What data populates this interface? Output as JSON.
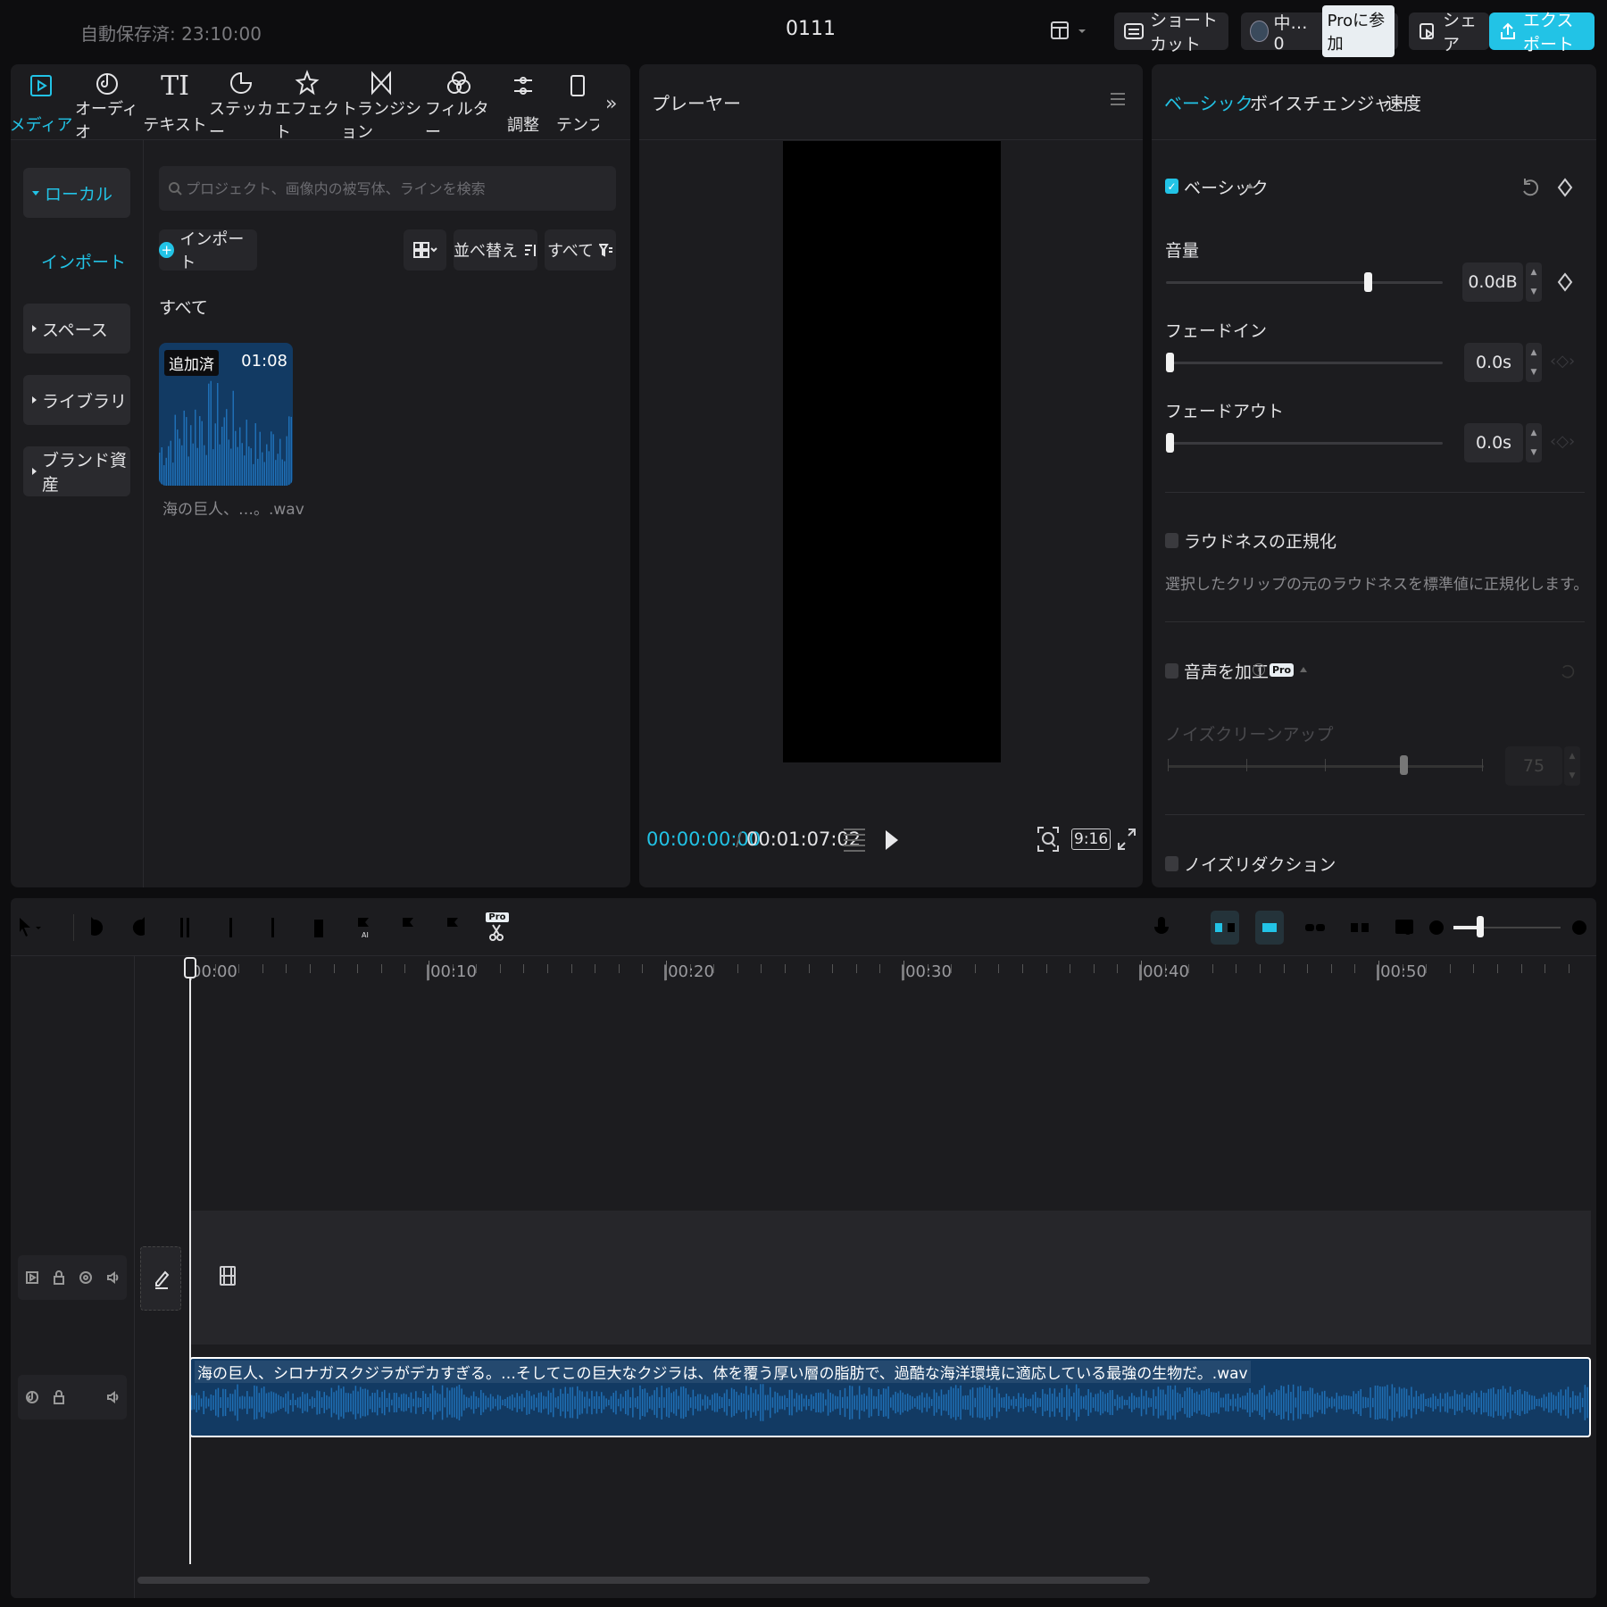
{
  "topbar": {
    "autosave": "自動保存済: 23:10:00",
    "project_title": "0111",
    "shortcut_label": "ショートカット",
    "user_label": "中…0",
    "pro_join_label": "Proに参加",
    "share_label": "シェア",
    "export_label": "エクスポート"
  },
  "media_tabs": [
    {
      "label": "メディア",
      "icon": "media-icon"
    },
    {
      "label": "オーディオ",
      "icon": "audio-icon"
    },
    {
      "label": "テキスト",
      "icon": "text-icon",
      "glyph": "TI"
    },
    {
      "label": "ステッカー",
      "icon": "sticker-icon"
    },
    {
      "label": "エフェクト",
      "icon": "effect-icon"
    },
    {
      "label": "トランジション",
      "icon": "transition-icon"
    },
    {
      "label": "フィルター",
      "icon": "filter-icon"
    },
    {
      "label": "調整",
      "icon": "adjust-icon"
    },
    {
      "label": "テンプ",
      "icon": "template-icon"
    }
  ],
  "sidebar": {
    "local": "ローカル",
    "import": "インポート",
    "space": "スペース",
    "library": "ライブラリ",
    "brand": "ブランド資産"
  },
  "media": {
    "search_placeholder": "プロジェクト、画像内の被写体、ラインを検索",
    "import_label": "インポート",
    "sort_label": "並べ替え",
    "filter_label": "すべて",
    "section_title": "すべて",
    "clip": {
      "badge": "追加済",
      "duration": "01:08",
      "name": "海の巨人、…。.wav"
    }
  },
  "player": {
    "title": "プレーヤー",
    "current_time": "00:00:00:00",
    "separator": "/",
    "total_time": "00:01:07:02",
    "aspect": "9:16"
  },
  "inspector": {
    "tabs": [
      "ベーシック",
      "ボイスチェンジャー",
      "速度"
    ],
    "basic_section": "ベーシック",
    "volume_label": "音量",
    "volume_value": "0.0dB",
    "volume_level": 0.73,
    "fade_in_label": "フェードイン",
    "fade_in_value": "0.0s",
    "fade_out_label": "フェードアウト",
    "fade_out_value": "0.0s",
    "loudness_label": "ラウドネスの正規化",
    "loudness_desc": "選択したクリップの元のラウドネスを標準値に正規化します。",
    "enhance_label": "音声を加工",
    "pro_badge": "Pro",
    "noise_clean_label": "ノイズクリーンアップ",
    "noise_clean_value": "75",
    "noise_reduction_label": "ノイズリダクション"
  },
  "timeline": {
    "ticks": [
      "00:00",
      "|00:10",
      "|00:20",
      "|00:30",
      "|00:40",
      "|00:50"
    ],
    "audio_clip_label": "海の巨人、シロナガスクジラがデカすぎる。…そしてこの巨大なクジラは、体を覆う厚い層の脂肪で、過酷な海洋環境に適応している最強の生物だ。.wav",
    "pro_badge": "Pro"
  },
  "colors": {
    "accent": "#22c3e6",
    "panel": "#1c1c1f",
    "clip_blue": "#123a63",
    "wave_blue": "#1f6fb5"
  }
}
